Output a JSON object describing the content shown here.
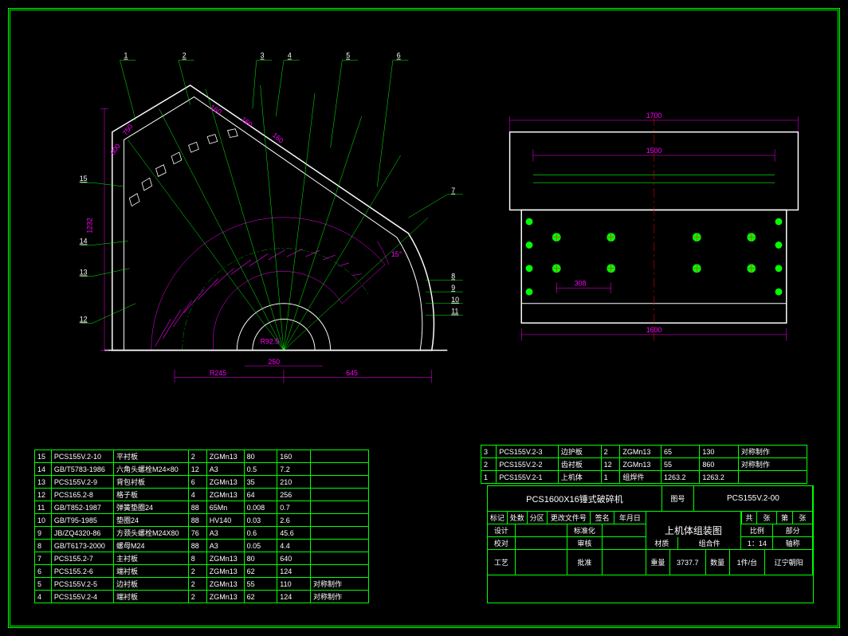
{
  "domain": "Diagram",
  "product": {
    "model": "PCS1600X16锤式破碎机",
    "assembly_title": "上机体组装图",
    "drawing_number_label": "图号",
    "drawing_number": "PCS155V.2-00",
    "scale_label": "比例",
    "scale": "1：14",
    "sheet_label_a": "共",
    "sheet_label_b": "张",
    "sheet_label_c": "第",
    "mass_label": "重量",
    "mass": "3737.7",
    "qty_label": "数量",
    "qty": "1件/台",
    "material_label": "材质",
    "material": "组合件",
    "location": "辽宁朝阳",
    "section_label": "部分",
    "axis_label": "轴称"
  },
  "title_block_labels": {
    "mark": "标记",
    "section": "处数",
    "zone": "分区",
    "change_doc": "更改文件号",
    "sign": "签名",
    "date": "年月日",
    "design": "设计",
    "standard": "标准化",
    "check": "校对",
    "review": "审核",
    "process": "工艺",
    "approve": "批准"
  },
  "dimensions": {
    "left_view": {
      "height": "1232",
      "radial_1": "R245",
      "center_offset": "250",
      "half_width": "645",
      "small_r": "R92.5",
      "angle_seg": "15°",
      "top_dim_a": "600",
      "top_dim_b": "750",
      "arc_seg": "160"
    },
    "right_view": {
      "overall_w": "1700",
      "inner_w": "1500",
      "lower_w": "1600",
      "bolt_pitch": "308"
    }
  },
  "callouts_left": [
    "1",
    "2",
    "3",
    "4",
    "5",
    "6",
    "7",
    "8",
    "9",
    "10",
    "11",
    "12",
    "13",
    "14",
    "15"
  ],
  "bom_left": [
    {
      "no": "15",
      "code": "PCS155V.2-10",
      "name": "平衬板",
      "qty": "2",
      "mat": "ZGMn13",
      "a": "80",
      "b": "160",
      "note": ""
    },
    {
      "no": "14",
      "code": "GB/T5783-1986",
      "name": "六角头螺栓M24×80",
      "qty": "12",
      "mat": "A3",
      "a": "0.5",
      "b": "7.2",
      "note": ""
    },
    {
      "no": "13",
      "code": "PCS155V.2-9",
      "name": "背包衬板",
      "qty": "6",
      "mat": "ZGMn13",
      "a": "35",
      "b": "210",
      "note": ""
    },
    {
      "no": "12",
      "code": "PCS165.2-8",
      "name": "格子板",
      "qty": "4",
      "mat": "ZGMn13",
      "a": "64",
      "b": "256",
      "note": ""
    },
    {
      "no": "11",
      "code": "GB/T852-1987",
      "name": "弹簧垫圈24",
      "qty": "88",
      "mat": "65Mn",
      "a": "0.008",
      "b": "0.7",
      "note": ""
    },
    {
      "no": "10",
      "code": "GB/T95-1985",
      "name": "垫圈24",
      "qty": "88",
      "mat": "HV140",
      "a": "0.03",
      "b": "2.6",
      "note": ""
    },
    {
      "no": "9",
      "code": "JB/ZQ4320-86",
      "name": "方颈头螺栓M24X80",
      "qty": "76",
      "mat": "A3",
      "a": "0.6",
      "b": "45.6",
      "note": ""
    },
    {
      "no": "8",
      "code": "GB/T6173-2000",
      "name": "螺母M24",
      "qty": "88",
      "mat": "A3",
      "a": "0.05",
      "b": "4.4",
      "note": ""
    },
    {
      "no": "7",
      "code": "PCS155.2-7",
      "name": "主衬板",
      "qty": "8",
      "mat": "ZGMn13",
      "a": "80",
      "b": "640",
      "note": ""
    },
    {
      "no": "6",
      "code": "PCS155.2-6",
      "name": "端衬板",
      "qty": "2",
      "mat": "ZGMn13",
      "a": "62",
      "b": "124",
      "note": ""
    },
    {
      "no": "5",
      "code": "PCS155V.2-5",
      "name": "边衬板",
      "qty": "2",
      "mat": "ZGMn13",
      "a": "55",
      "b": "110",
      "note": "对称制作"
    },
    {
      "no": "4",
      "code": "PCS155V.2-4",
      "name": "端衬板",
      "qty": "2",
      "mat": "ZGMn13",
      "a": "62",
      "b": "124",
      "note": "对称制作"
    }
  ],
  "bom_right": [
    {
      "no": "3",
      "code": "PCS155V.2-3",
      "name": "边护板",
      "qty": "2",
      "mat": "ZGMn13",
      "a": "65",
      "b": "130",
      "note": "对称制作"
    },
    {
      "no": "2",
      "code": "PCS155V.2-2",
      "name": "齿衬板",
      "qty": "12",
      "mat": "ZGMn13",
      "a": "55",
      "b": "860",
      "note": "对称制作"
    },
    {
      "no": "1",
      "code": "PCS155V.2-1",
      "name": "上机体",
      "qty": "1",
      "mat": "组焊件",
      "a": "1263.2",
      "b": "1263.2",
      "note": ""
    }
  ]
}
